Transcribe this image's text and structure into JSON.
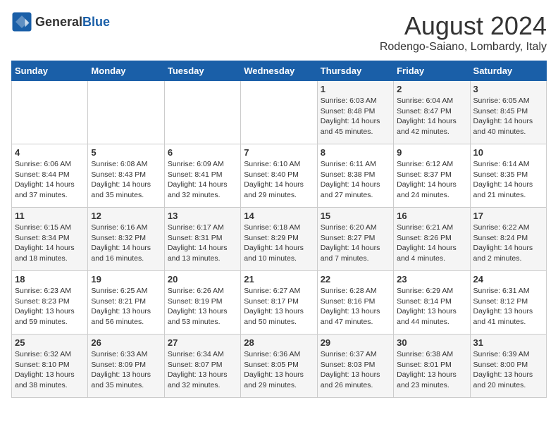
{
  "header": {
    "logo_general": "General",
    "logo_blue": "Blue",
    "month": "August 2024",
    "location": "Rodengo-Saiano, Lombardy, Italy"
  },
  "weekdays": [
    "Sunday",
    "Monday",
    "Tuesday",
    "Wednesday",
    "Thursday",
    "Friday",
    "Saturday"
  ],
  "weeks": [
    [
      {
        "day": "",
        "info": ""
      },
      {
        "day": "",
        "info": ""
      },
      {
        "day": "",
        "info": ""
      },
      {
        "day": "",
        "info": ""
      },
      {
        "day": "1",
        "info": "Sunrise: 6:03 AM\nSunset: 8:48 PM\nDaylight: 14 hours and 45 minutes."
      },
      {
        "day": "2",
        "info": "Sunrise: 6:04 AM\nSunset: 8:47 PM\nDaylight: 14 hours and 42 minutes."
      },
      {
        "day": "3",
        "info": "Sunrise: 6:05 AM\nSunset: 8:45 PM\nDaylight: 14 hours and 40 minutes."
      }
    ],
    [
      {
        "day": "4",
        "info": "Sunrise: 6:06 AM\nSunset: 8:44 PM\nDaylight: 14 hours and 37 minutes."
      },
      {
        "day": "5",
        "info": "Sunrise: 6:08 AM\nSunset: 8:43 PM\nDaylight: 14 hours and 35 minutes."
      },
      {
        "day": "6",
        "info": "Sunrise: 6:09 AM\nSunset: 8:41 PM\nDaylight: 14 hours and 32 minutes."
      },
      {
        "day": "7",
        "info": "Sunrise: 6:10 AM\nSunset: 8:40 PM\nDaylight: 14 hours and 29 minutes."
      },
      {
        "day": "8",
        "info": "Sunrise: 6:11 AM\nSunset: 8:38 PM\nDaylight: 14 hours and 27 minutes."
      },
      {
        "day": "9",
        "info": "Sunrise: 6:12 AM\nSunset: 8:37 PM\nDaylight: 14 hours and 24 minutes."
      },
      {
        "day": "10",
        "info": "Sunrise: 6:14 AM\nSunset: 8:35 PM\nDaylight: 14 hours and 21 minutes."
      }
    ],
    [
      {
        "day": "11",
        "info": "Sunrise: 6:15 AM\nSunset: 8:34 PM\nDaylight: 14 hours and 18 minutes."
      },
      {
        "day": "12",
        "info": "Sunrise: 6:16 AM\nSunset: 8:32 PM\nDaylight: 14 hours and 16 minutes."
      },
      {
        "day": "13",
        "info": "Sunrise: 6:17 AM\nSunset: 8:31 PM\nDaylight: 14 hours and 13 minutes."
      },
      {
        "day": "14",
        "info": "Sunrise: 6:18 AM\nSunset: 8:29 PM\nDaylight: 14 hours and 10 minutes."
      },
      {
        "day": "15",
        "info": "Sunrise: 6:20 AM\nSunset: 8:27 PM\nDaylight: 14 hours and 7 minutes."
      },
      {
        "day": "16",
        "info": "Sunrise: 6:21 AM\nSunset: 8:26 PM\nDaylight: 14 hours and 4 minutes."
      },
      {
        "day": "17",
        "info": "Sunrise: 6:22 AM\nSunset: 8:24 PM\nDaylight: 14 hours and 2 minutes."
      }
    ],
    [
      {
        "day": "18",
        "info": "Sunrise: 6:23 AM\nSunset: 8:23 PM\nDaylight: 13 hours and 59 minutes."
      },
      {
        "day": "19",
        "info": "Sunrise: 6:25 AM\nSunset: 8:21 PM\nDaylight: 13 hours and 56 minutes."
      },
      {
        "day": "20",
        "info": "Sunrise: 6:26 AM\nSunset: 8:19 PM\nDaylight: 13 hours and 53 minutes."
      },
      {
        "day": "21",
        "info": "Sunrise: 6:27 AM\nSunset: 8:17 PM\nDaylight: 13 hours and 50 minutes."
      },
      {
        "day": "22",
        "info": "Sunrise: 6:28 AM\nSunset: 8:16 PM\nDaylight: 13 hours and 47 minutes."
      },
      {
        "day": "23",
        "info": "Sunrise: 6:29 AM\nSunset: 8:14 PM\nDaylight: 13 hours and 44 minutes."
      },
      {
        "day": "24",
        "info": "Sunrise: 6:31 AM\nSunset: 8:12 PM\nDaylight: 13 hours and 41 minutes."
      }
    ],
    [
      {
        "day": "25",
        "info": "Sunrise: 6:32 AM\nSunset: 8:10 PM\nDaylight: 13 hours and 38 minutes."
      },
      {
        "day": "26",
        "info": "Sunrise: 6:33 AM\nSunset: 8:09 PM\nDaylight: 13 hours and 35 minutes."
      },
      {
        "day": "27",
        "info": "Sunrise: 6:34 AM\nSunset: 8:07 PM\nDaylight: 13 hours and 32 minutes."
      },
      {
        "day": "28",
        "info": "Sunrise: 6:36 AM\nSunset: 8:05 PM\nDaylight: 13 hours and 29 minutes."
      },
      {
        "day": "29",
        "info": "Sunrise: 6:37 AM\nSunset: 8:03 PM\nDaylight: 13 hours and 26 minutes."
      },
      {
        "day": "30",
        "info": "Sunrise: 6:38 AM\nSunset: 8:01 PM\nDaylight: 13 hours and 23 minutes."
      },
      {
        "day": "31",
        "info": "Sunrise: 6:39 AM\nSunset: 8:00 PM\nDaylight: 13 hours and 20 minutes."
      }
    ]
  ]
}
